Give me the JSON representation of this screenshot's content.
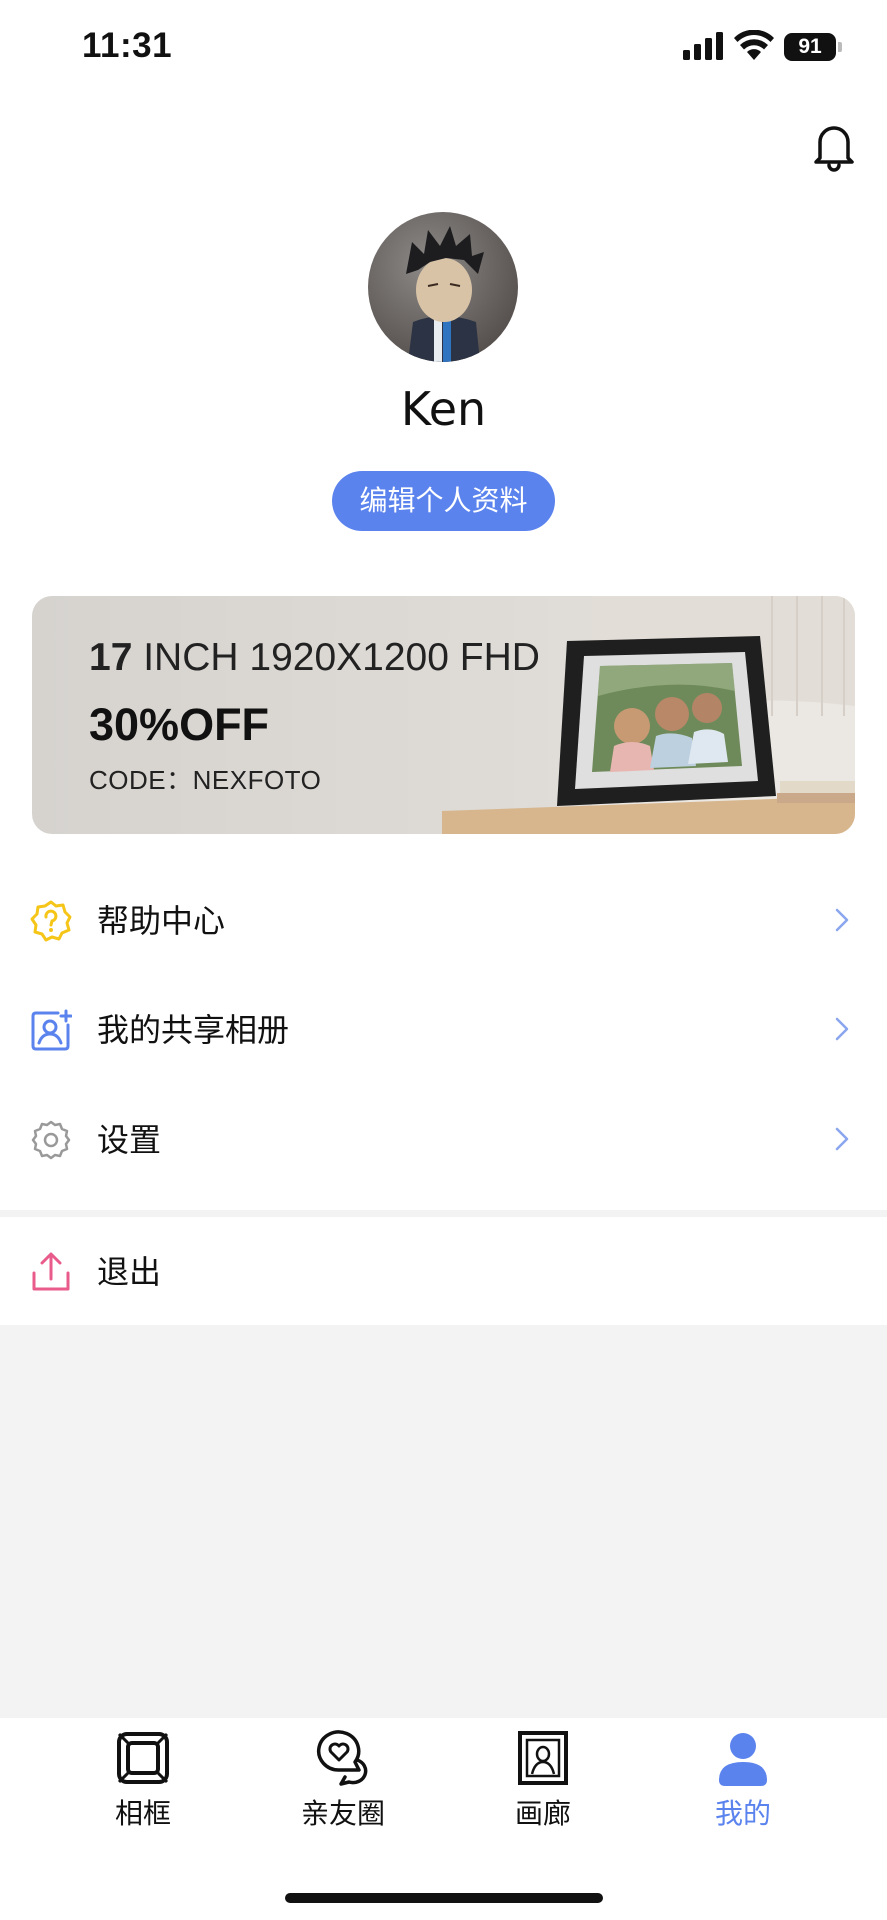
{
  "status_bar": {
    "time": "11:31",
    "battery": "91"
  },
  "profile": {
    "name": "Ken",
    "edit_label": "编辑个人资料"
  },
  "banner": {
    "size": "17",
    "spec": " INCH 1920X1200 FHD",
    "offer": "30%OFF",
    "code": "CODE：NEXFOTO"
  },
  "menu": {
    "items": [
      {
        "label": "帮助中心",
        "icon": "help-badge-icon"
      },
      {
        "label": "我的共享相册",
        "icon": "shared-album-icon"
      },
      {
        "label": "设置",
        "icon": "gear-icon"
      }
    ],
    "logout": {
      "label": "退出",
      "icon": "upload-icon"
    }
  },
  "tabs": [
    {
      "label": "相框",
      "icon": "frame-icon",
      "active": false
    },
    {
      "label": "亲友圈",
      "icon": "heart-chat-icon",
      "active": false
    },
    {
      "label": "画廊",
      "icon": "gallery-icon",
      "active": false
    },
    {
      "label": "我的",
      "icon": "person-icon",
      "active": true
    }
  ],
  "colors": {
    "accent": "#5b83ee",
    "help_icon": "#f5c518",
    "logout_icon": "#e95b8a",
    "background": "#f3f3f3"
  }
}
